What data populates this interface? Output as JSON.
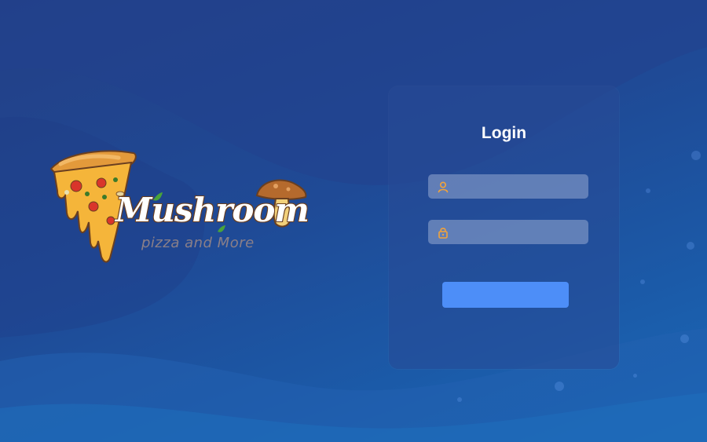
{
  "brand": {
    "title": "Mushroom",
    "tagline": "pizza and More",
    "logo_icon": "pizza-slice-icon",
    "mascot_icon": "mushroom-icon"
  },
  "login": {
    "title": "Login",
    "username": {
      "value": "",
      "placeholder": "",
      "icon": "user-icon"
    },
    "password": {
      "value": "",
      "placeholder": "",
      "icon": "lock-icon"
    },
    "submit_label": ""
  },
  "colors": {
    "background": "#1f4a96",
    "card": "#284b96",
    "field": "#96aad2",
    "button": "#4d8ef8",
    "icon_accent": "#f2a33a"
  }
}
